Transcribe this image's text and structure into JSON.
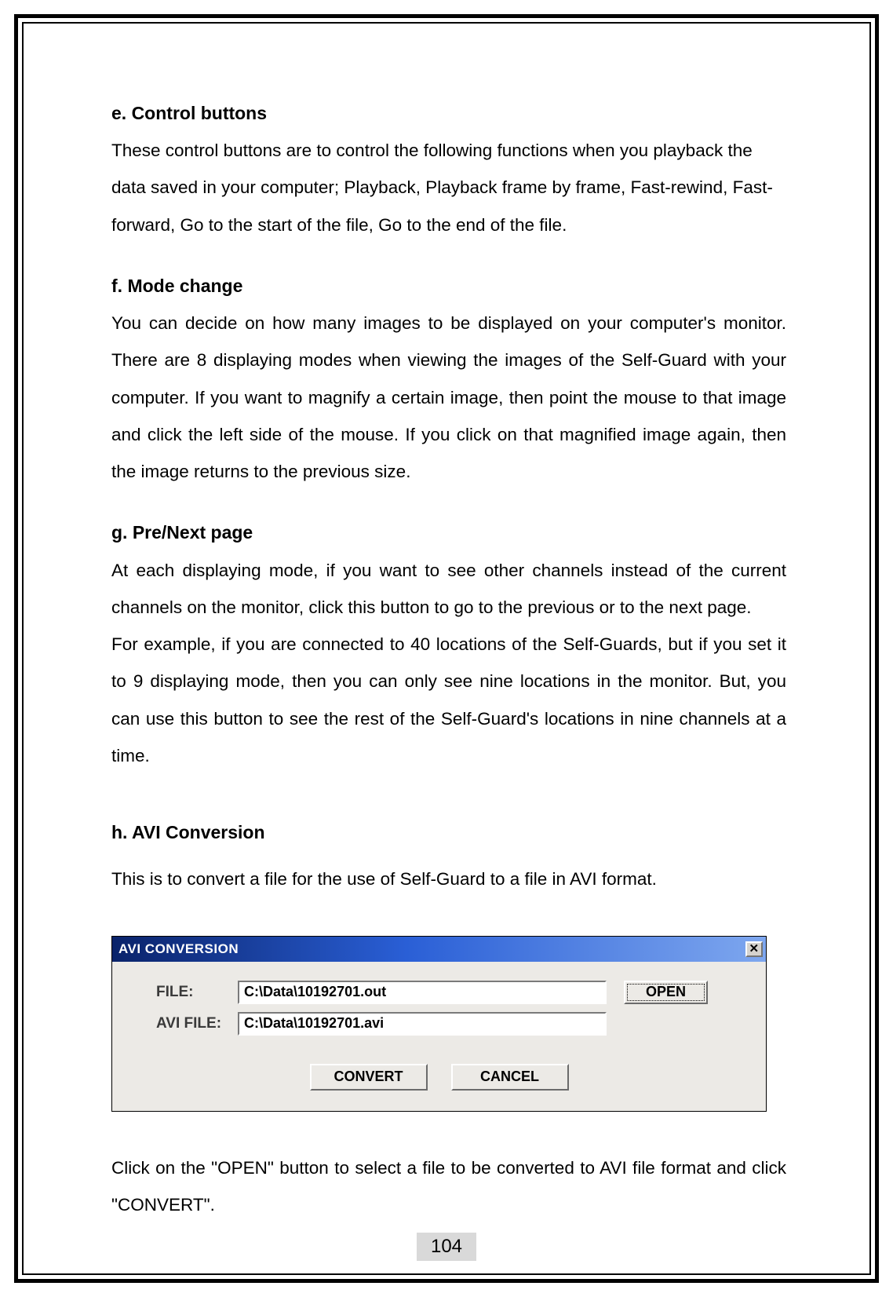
{
  "sections": {
    "e": {
      "heading": "e. Control buttons",
      "body": "These control buttons are to control the following functions when you playback the data saved in your computer; Playback, Playback frame by frame, Fast-rewind, Fast-forward, Go to the start of the file, Go to the end of the file."
    },
    "f": {
      "heading": "f. Mode change",
      "body": "You can decide on how many images to be displayed on your computer's monitor. There are 8 displaying modes when viewing the images of the Self-Guard with your computer. If you want to magnify a certain image, then point the mouse to that image and click the left side of the mouse. If you click on that magnified image again, then the image returns to the previous size."
    },
    "g": {
      "heading": "g. Pre/Next page",
      "body1": "At each displaying mode, if you want to see other channels instead of the current channels on the monitor, click this button to go to the previous or to the next page.",
      "body2": "For example, if you are connected to 40 locations of the Self-Guards, but if you set it to 9 displaying mode, then you can only see nine locations in the monitor. But, you can use this button to see the rest of the Self-Guard's locations in nine channels at a time."
    },
    "h": {
      "heading": "h. AVI Conversion",
      "body": "This is to convert a file for the use of Self-Guard to a file in AVI format.",
      "closing": "Click on the \"OPEN\" button to select a file to be converted to AVI file format and click \"CONVERT\"."
    }
  },
  "dialog": {
    "title": "AVI CONVERSION",
    "close_glyph": "✕",
    "file_label": "FILE:",
    "file_value": "C:\\Data\\10192701.out",
    "avi_label": "AVI FILE:",
    "avi_value": "C:\\Data\\10192701.avi",
    "open_btn": "OPEN",
    "convert_btn": "CONVERT",
    "cancel_btn": "CANCEL"
  },
  "page_number": "104"
}
